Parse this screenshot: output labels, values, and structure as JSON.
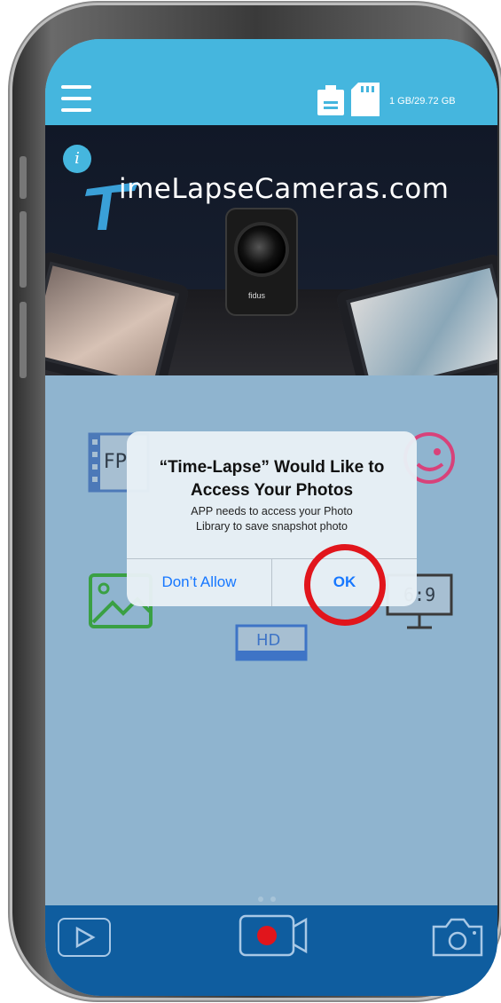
{
  "status": {
    "storage_text": "1 GB/29.72 GB"
  },
  "preview": {
    "logo_text": "imeLapseCameras.com",
    "info_badge": "i",
    "camera_brand": "fidus"
  },
  "features": {
    "fps_label": "FP",
    "hd_label": "HD",
    "ratio_label": "6:9"
  },
  "alert": {
    "title_line1": "“Time-Lapse” Would Like to",
    "title_line2": "Access Your Photos",
    "message_line1": "APP needs to access your Photo",
    "message_line2": "Library to save snapshot photo",
    "deny_label": "Don’t Allow",
    "ok_label": "OK"
  },
  "colors": {
    "topbar": "#45b6de",
    "content": "#8fb4cf",
    "bottombar": "#0f5d9f",
    "highlight_circle": "#e1151c",
    "alert_button": "#1677ff"
  },
  "pager": {
    "pages": 2,
    "current": 1
  }
}
